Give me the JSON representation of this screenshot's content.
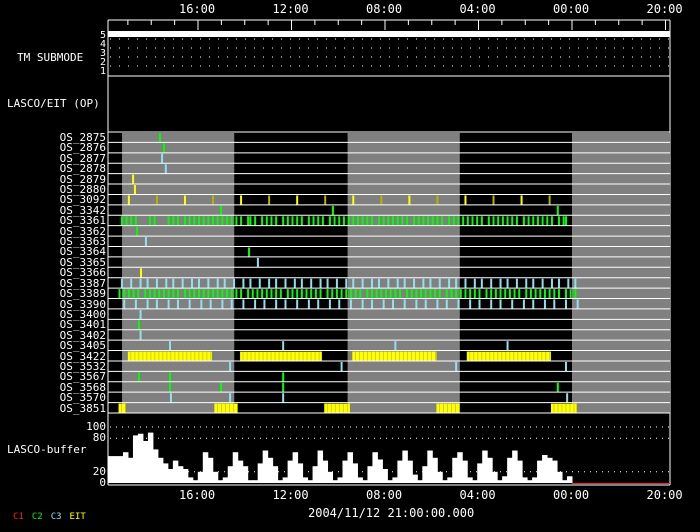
{
  "chart_data": {
    "type": "timeline",
    "x_axis": {
      "tick_labels": [
        "16:00",
        "12:00",
        "08:00",
        "04:00",
        "00:00",
        "20:00"
      ],
      "unit_note_hours_per_label": 4,
      "range_hours": [
        -3.85,
        20.15
      ]
    },
    "footer_date": "2004/11/12 21:00:00.000",
    "legend": [
      {
        "label": "C1",
        "color": "#ff2020"
      },
      {
        "label": "C2",
        "color": "#00ff00"
      },
      {
        "label": "C3",
        "color": "#90e0f0"
      },
      {
        "label": "EIT",
        "color": "#ffff00"
      }
    ],
    "submode_panel": {
      "label": "TM SUBMODE",
      "levels": [
        "5",
        "4",
        "3",
        "2",
        "1"
      ],
      "value": 5
    },
    "op_panel": {
      "label": "LASCO/EIT (OP)"
    },
    "gray_bands": [
      [
        -3.25,
        1.55
      ],
      [
        6.4,
        11.2
      ],
      [
        16.0,
        20.2
      ]
    ],
    "colors": {
      "gray": "#808080",
      "yellow": "#ffff00",
      "olive": "#b4b400",
      "green": "#00ff00",
      "cyan": "#90e0f0",
      "red": "#ff2020"
    },
    "rows": [
      {
        "label": "OS_2875",
        "events": [
          {
            "c": "green",
            "t": [
              -1.67
            ]
          }
        ]
      },
      {
        "label": "OS_2876",
        "events": [
          {
            "c": "green",
            "t": [
              -1.5
            ]
          }
        ]
      },
      {
        "label": "OS_2877",
        "events": [
          {
            "c": "cyan",
            "t": [
              -1.58
            ]
          }
        ]
      },
      {
        "label": "OS_2878",
        "events": [
          {
            "c": "cyan",
            "t": [
              -1.42
            ]
          }
        ]
      },
      {
        "label": "OS_2879",
        "events": [
          {
            "c": "yellow",
            "t": [
              -2.82
            ]
          }
        ]
      },
      {
        "label": "OS_2880",
        "events": [
          {
            "c": "yellow",
            "t": [
              -2.74
            ]
          }
        ]
      },
      {
        "label": "OS_3092",
        "events": [
          {
            "c": "yellow",
            "t": [
              -3.0,
              -0.6,
              1.8,
              4.2,
              6.6,
              9.0,
              11.4,
              13.8
            ]
          },
          {
            "c": "olive",
            "t": [
              -1.8,
              0.6,
              3.0,
              5.4,
              7.8,
              10.2,
              12.6,
              15.0
            ]
          }
        ]
      },
      {
        "label": "OS_3342",
        "events": [
          {
            "c": "green",
            "t": [
              0.94,
              5.73,
              15.35
            ]
          }
        ]
      },
      {
        "label": "OS_3361",
        "events": [
          {
            "c": "green",
            "t": [
              -3.3,
              -3.1,
              -2.9,
              -2.7,
              -2.1,
              -1.9,
              -1.3,
              -1.1,
              -0.9,
              -0.6,
              -0.4,
              -0.2,
              0,
              0.2,
              0.4,
              0.6,
              0.8,
              1.0,
              1.2,
              1.4,
              1.6,
              1.8,
              2.1,
              2.2,
              2.4,
              2.7,
              2.9,
              3.1,
              3.3,
              3.6,
              3.8,
              4.0,
              4.2,
              4.4,
              4.7,
              4.9,
              5.1,
              5.3,
              5.6,
              5.8,
              6.0,
              6.2,
              6.4,
              6.6,
              6.8,
              7.0,
              7.2,
              7.4,
              7.7,
              7.9,
              8.1,
              8.3,
              8.5,
              8.7,
              8.9,
              9.2,
              9.4,
              9.6,
              9.8,
              10.0,
              10.2,
              10.4,
              10.7,
              10.9,
              11.1,
              11.3,
              11.5,
              11.7,
              11.9,
              12.1,
              12.4,
              12.6,
              12.8,
              13.0,
              13.2,
              13.4,
              13.6,
              13.9,
              14.1,
              14.3,
              14.5,
              14.7,
              14.9,
              15.1,
              15.4,
              15.6,
              15.7
            ]
          }
        ]
      },
      {
        "label": "OS_3362",
        "events": [
          {
            "c": "green",
            "t": [
              -2.65
            ]
          }
        ]
      },
      {
        "label": "OS_3363",
        "events": [
          {
            "c": "cyan",
            "t": [
              -2.27
            ]
          }
        ]
      },
      {
        "label": "OS_3364",
        "events": [
          {
            "c": "green",
            "t": [
              2.14
            ]
          }
        ]
      },
      {
        "label": "OS_3365",
        "events": [
          {
            "c": "cyan",
            "t": [
              2.52
            ]
          }
        ]
      },
      {
        "label": "OS_3366",
        "events": [
          {
            "c": "yellow",
            "t": [
              -2.48
            ]
          }
        ]
      },
      {
        "label": "OS_3387",
        "events": [
          {
            "c": "cyan",
            "t": [
              -3.3,
              -2.9,
              -2.5,
              -2.2,
              -1.8,
              -1.4,
              -1.1,
              -0.7,
              -0.3,
              0,
              0.4,
              0.8,
              1.1,
              1.5,
              1.9,
              2.2,
              2.6,
              3.0,
              3.3,
              3.7,
              4.1,
              4.4,
              4.8,
              5.2,
              5.5,
              5.9,
              6.3,
              6.6,
              7.0,
              7.4,
              7.7,
              8.1,
              8.5,
              8.8,
              9.2,
              9.6,
              9.9,
              10.3,
              10.7,
              11.0,
              11.4,
              11.8,
              12.1,
              12.5,
              12.9,
              13.2,
              13.6,
              14.0,
              14.3,
              14.7,
              15.1,
              15.4,
              15.8,
              16.1
            ]
          }
        ]
      },
      {
        "label": "OS_3389",
        "events": [
          {
            "c": "green",
            "t": [
              -3.4,
              -3.2,
              -3.0,
              -2.8,
              -2.6,
              -2.3,
              -2.1,
              -1.9,
              -1.7,
              -1.5,
              -1.3,
              -1.1,
              -0.9,
              -0.6,
              -0.4,
              -0.2,
              0,
              0.2,
              0.4,
              0.6,
              0.8,
              1.0,
              1.2,
              1.4,
              1.6,
              1.8,
              2.1,
              2.3,
              2.5,
              2.7,
              2.9,
              3.1,
              3.3,
              3.5,
              3.8,
              4.0,
              4.2,
              4.4,
              4.6,
              4.8,
              5.0,
              5.2,
              5.5,
              5.7,
              5.9,
              6.1,
              6.3,
              6.5,
              6.7,
              6.9,
              7.2,
              7.4,
              7.6,
              7.8,
              8.0,
              8.2,
              8.4,
              8.6,
              8.9,
              9.1,
              9.3,
              9.5,
              9.7,
              9.9,
              10.1,
              10.3,
              10.6,
              10.8,
              11.0,
              11.2,
              11.4,
              11.6,
              11.8,
              12.0,
              12.3,
              12.5,
              12.7,
              12.9,
              13.1,
              13.3,
              13.5,
              13.7,
              14.0,
              14.2,
              14.4,
              14.6,
              14.8,
              15.0,
              15.2,
              15.4,
              15.7,
              15.9,
              16.1
            ]
          }
        ]
      },
      {
        "label": "OS_3390",
        "events": [
          {
            "c": "cyan",
            "t": [
              -3.2,
              -2.7,
              -2.2,
              -1.8,
              -1.3,
              -0.9,
              -0.4,
              0.1,
              0.5,
              1.0,
              1.4,
              1.9,
              2.4,
              2.8,
              3.3,
              3.7,
              4.2,
              4.7,
              5.1,
              5.6,
              6.0,
              6.5,
              7.0,
              7.4,
              7.9,
              8.3,
              8.8,
              9.3,
              9.7,
              10.2,
              10.6,
              11.1,
              11.6,
              12.0,
              12.5,
              12.9,
              13.4,
              13.9,
              14.3,
              14.8,
              15.2,
              15.7,
              16.2
            ]
          }
        ]
      },
      {
        "label": "OS_3400",
        "events": [
          {
            "c": "cyan",
            "t": [
              -2.5
            ]
          }
        ]
      },
      {
        "label": "OS_3401",
        "events": [
          {
            "c": "green",
            "t": [
              -2.57
            ]
          }
        ]
      },
      {
        "label": "OS_3402",
        "events": [
          {
            "c": "cyan",
            "t": [
              -2.5
            ]
          }
        ]
      },
      {
        "label": "OS_3405",
        "events": [
          {
            "c": "cyan",
            "t": [
              -1.24,
              3.6,
              8.4,
              13.2
            ]
          }
        ]
      },
      {
        "label": "OS_3422",
        "spans": [
          {
            "c": "yellow",
            "t": [
              [
                -3.0,
                0.6
              ],
              [
                1.8,
                5.3
              ],
              [
                6.6,
                10.2
              ],
              [
                11.5,
                15.1
              ]
            ]
          }
        ]
      },
      {
        "label": "OS_3532",
        "events": [
          {
            "c": "cyan",
            "t": [
              1.33,
              6.1,
              11.0,
              15.7
            ]
          }
        ]
      },
      {
        "label": "OS_3567",
        "events": [
          {
            "c": "green",
            "t": [
              -2.57,
              -1.24,
              3.6
            ]
          }
        ]
      },
      {
        "label": "OS_3568",
        "events": [
          {
            "c": "green",
            "t": [
              -1.24,
              0.94,
              3.6,
              15.35
            ]
          }
        ]
      },
      {
        "label": "OS_3570",
        "events": [
          {
            "c": "cyan",
            "t": [
              -1.2,
              1.33,
              3.6,
              15.75
            ]
          }
        ]
      },
      {
        "label": "OS_3851",
        "spans": [
          {
            "c": "yellow",
            "t": [
              [
                -3.4,
                -3.1
              ],
              [
                0.7,
                1.7
              ],
              [
                5.4,
                6.5
              ],
              [
                10.2,
                11.2
              ],
              [
                15.1,
                16.2
              ]
            ]
          }
        ]
      }
    ],
    "buffer_panel": {
      "label": "LASCO-buffer",
      "ylim": [
        0,
        100
      ],
      "y_tick_labels": [
        "100",
        "80",
        "20",
        "0"
      ],
      "values": [
        48,
        48,
        48,
        55,
        45,
        85,
        88,
        75,
        90,
        60,
        45,
        35,
        25,
        40,
        30,
        25,
        10,
        5,
        20,
        55,
        45,
        20,
        5,
        10,
        30,
        55,
        40,
        30,
        5,
        5,
        35,
        58,
        45,
        30,
        5,
        10,
        40,
        55,
        35,
        10,
        5,
        30,
        58,
        40,
        20,
        5,
        10,
        40,
        55,
        35,
        10,
        5,
        30,
        55,
        42,
        25,
        5,
        10,
        40,
        58,
        40,
        15,
        5,
        30,
        58,
        45,
        20,
        5,
        10,
        45,
        55,
        40,
        10,
        5,
        35,
        58,
        45,
        20,
        5,
        12,
        45,
        58,
        40,
        10,
        5,
        10,
        40,
        50,
        45,
        40,
        20,
        5,
        12,
        0
      ]
    }
  }
}
